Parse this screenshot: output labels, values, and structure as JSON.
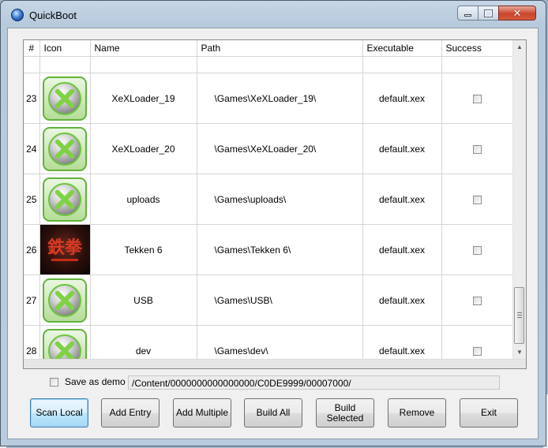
{
  "window": {
    "title": "QuickBoot",
    "controls": {
      "minimize": "minimize",
      "maximize": "maximize",
      "close": "✕"
    }
  },
  "grid": {
    "columns": [
      "#",
      "Icon",
      "Name",
      "Path",
      "Executable",
      "Success"
    ],
    "rows": [
      {
        "num": "",
        "icon": "xbox-icon",
        "name": "",
        "path": "",
        "exe": "",
        "success": false
      },
      {
        "num": "23",
        "icon": "xbox-icon",
        "name": "XeXLoader_19",
        "path": "\\Games\\XeXLoader_19\\",
        "exe": "default.xex",
        "success": false
      },
      {
        "num": "24",
        "icon": "xbox-icon",
        "name": "XeXLoader_20",
        "path": "\\Games\\XeXLoader_20\\",
        "exe": "default.xex",
        "success": false
      },
      {
        "num": "25",
        "icon": "xbox-icon",
        "name": "uploads",
        "path": "\\Games\\uploads\\",
        "exe": "default.xex",
        "success": false
      },
      {
        "num": "26",
        "icon": "tekken-icon",
        "name": "Tekken 6",
        "path": "\\Games\\Tekken 6\\",
        "exe": "default.xex",
        "success": false
      },
      {
        "num": "27",
        "icon": "xbox-icon",
        "name": "USB",
        "path": "\\Games\\USB\\",
        "exe": "default.xex",
        "success": false
      },
      {
        "num": "28",
        "icon": "xbox-icon",
        "name": "dev",
        "path": "\\Games\\dev\\",
        "exe": "default.xex",
        "success": false
      }
    ],
    "scroll_position": 0.93
  },
  "demo": {
    "label": "Save as demo",
    "checked": false,
    "path": "/Content/0000000000000000/C0DE9999/00007000/"
  },
  "buttons": {
    "scan_local": "Scan Local",
    "add_entry": "Add Entry",
    "add_multiple": "Add Multiple",
    "build_all": "Build All",
    "build_selected": "Build\nSelected",
    "remove": "Remove",
    "exit": "Exit"
  },
  "icon_glyphs": {
    "tekken": "鉄拳"
  },
  "colors": {
    "xbox_green": "#62b23a",
    "close_red": "#c9462c",
    "titlebar": "#c6d6e6"
  }
}
